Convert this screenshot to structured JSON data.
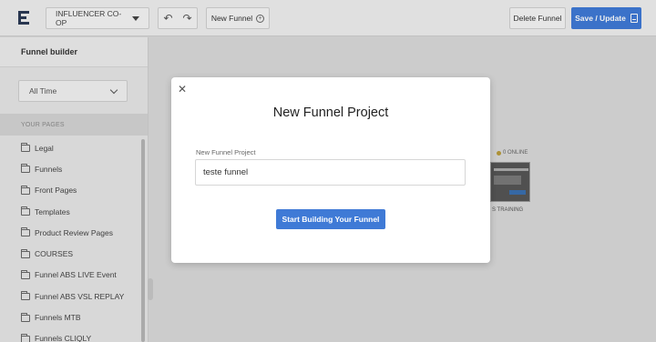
{
  "topbar": {
    "project_name": "INFLUENCER CO-OP",
    "undo_icon": "undo-icon",
    "redo_icon": "redo-icon",
    "new_funnel_label": "New Funnel",
    "delete_label": "Delete Funnel",
    "save_label": "Save / Update"
  },
  "sidebar": {
    "title": "Funnel builder",
    "filter_value": "All Time",
    "section_label": "YOUR PAGES",
    "items": [
      {
        "label": "Legal"
      },
      {
        "label": "Funnels"
      },
      {
        "label": "Front Pages"
      },
      {
        "label": "Templates"
      },
      {
        "label": "Product Review Pages"
      },
      {
        "label": "COURSES"
      },
      {
        "label": "Funnel ABS LIVE Event"
      },
      {
        "label": "Funnel ABS VSL REPLAY"
      },
      {
        "label": "Funnels MTB"
      },
      {
        "label": "Funnels CLIQLY"
      }
    ]
  },
  "background_card": {
    "online_text": "0 ONLINE",
    "caption": "S TRAINING"
  },
  "modal": {
    "title": "New Funnel Project",
    "field_label": "New Funnel Project",
    "field_value": "teste funnel",
    "submit_label": "Start Building Your Funnel"
  },
  "colors": {
    "accent": "#3f7ad6"
  }
}
